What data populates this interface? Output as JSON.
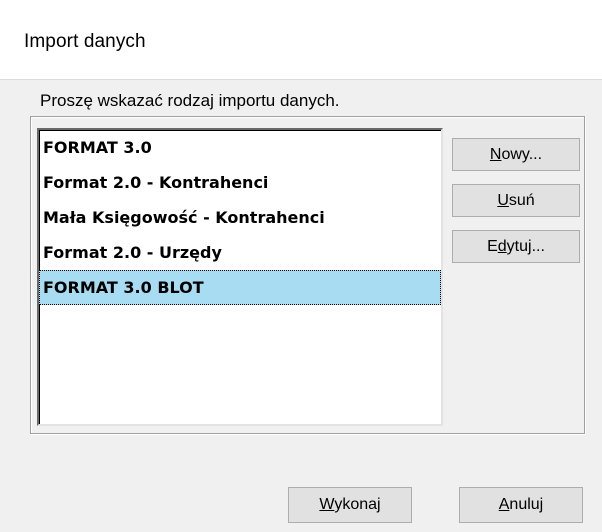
{
  "dialog": {
    "title": "Import danych",
    "prompt": "Proszę wskazać rodzaj importu danych."
  },
  "list": {
    "items": [
      {
        "label": "FORMAT 3.0",
        "selected": false
      },
      {
        "label": "Format 2.0 - Kontrahenci",
        "selected": false
      },
      {
        "label": "Mała Księgowość - Kontrahenci",
        "selected": false
      },
      {
        "label": "Format 2.0 - Urzędy",
        "selected": false
      },
      {
        "label": "FORMAT 3.0 BLOT",
        "selected": true
      }
    ],
    "selected_color": "#a8dcf2"
  },
  "buttons": {
    "new": {
      "mnemonic": "N",
      "rest": "owy..."
    },
    "delete": {
      "mnemonic": "U",
      "rest": "suń"
    },
    "edit": {
      "pre": "E",
      "mnemonic": "d",
      "rest": "ytuj..."
    },
    "execute": {
      "mnemonic": "W",
      "rest": "ykonaj"
    },
    "cancel": {
      "mnemonic": "A",
      "rest": "nuluj"
    }
  }
}
